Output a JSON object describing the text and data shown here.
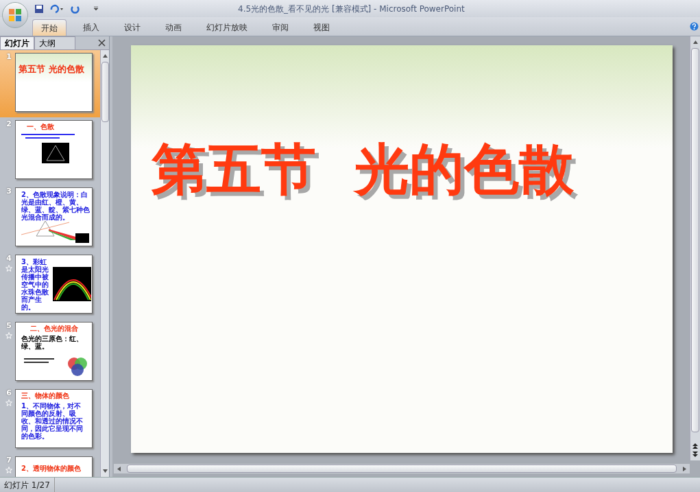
{
  "window": {
    "title": "4.5光的色散_看不见的光 [兼容模式] - Microsoft PowerPoint"
  },
  "ribbon_tabs": [
    {
      "label": "开始",
      "selected": true
    },
    {
      "label": "插入",
      "selected": false
    },
    {
      "label": "设计",
      "selected": false
    },
    {
      "label": "动画",
      "selected": false
    },
    {
      "label": "幻灯片放映",
      "selected": false
    },
    {
      "label": "审阅",
      "selected": false
    },
    {
      "label": "视图",
      "selected": false
    }
  ],
  "pane_tabs": [
    {
      "label": "幻灯片",
      "selected": true
    },
    {
      "label": "大纲",
      "selected": false
    }
  ],
  "slides": [
    {
      "number": "1",
      "selected": true,
      "animated": false,
      "kind": "title",
      "title": "第五节 光的色散"
    },
    {
      "number": "2",
      "selected": false,
      "animated": false,
      "kind": "prism",
      "title": "一、色散"
    },
    {
      "number": "3",
      "selected": false,
      "animated": false,
      "kind": "spectrum",
      "body": "2、色散现象说明：白光是由红、橙、黄、绿、蓝、靛、紫七种色光混合而成的。"
    },
    {
      "number": "4",
      "selected": false,
      "animated": true,
      "kind": "rainbow",
      "body": "3、彩虹是太阳光传播中被空气中的水珠色散而产生的。"
    },
    {
      "number": "5",
      "selected": false,
      "animated": true,
      "kind": "mixing",
      "title": "二、色光的混合",
      "body": "色光的三原色：红、绿、蓝。"
    },
    {
      "number": "6",
      "selected": false,
      "animated": true,
      "kind": "text",
      "title": "三、物体的颜色",
      "body": "1、不同物体，对不同颜色的反射、吸收、和透过的情况不同，因此它呈现不同的色彩。"
    },
    {
      "number": "7",
      "selected": false,
      "animated": true,
      "kind": "title_only",
      "title": "2、透明物体的颜色"
    }
  ],
  "main_slide": {
    "title": "第五节  光的色散"
  },
  "status_bar": {
    "slide_counter": "幻灯片 1/27"
  }
}
